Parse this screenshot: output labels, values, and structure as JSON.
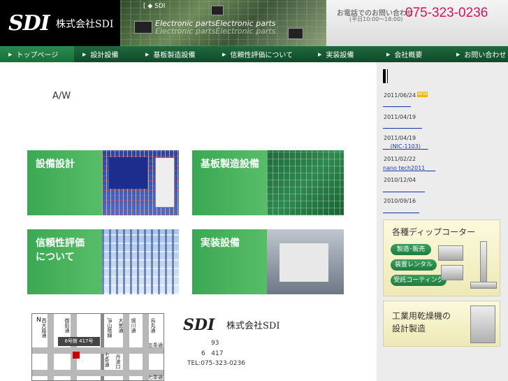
{
  "header": {
    "logo_mark": "SDI",
    "logo_text": "株式会社SDI",
    "sdi_tag": "[ ◆ SDI",
    "tagline1": "Electronic partsElectronic parts",
    "tagline2": "Electronic partsElectronic parts",
    "contact_label": "お電話でのお問い合わせ",
    "contact_hours": "(平日10:00〜18:00)",
    "contact_phone": "075-323-0236"
  },
  "nav": {
    "items": [
      {
        "label": "トップページ"
      },
      {
        "label": "設計設備"
      },
      {
        "label": "基板製造設備"
      },
      {
        "label": "信頼性評価について"
      },
      {
        "label": "実装設備"
      },
      {
        "label": "会社概要"
      },
      {
        "label": "お問い合わせ"
      }
    ],
    "arrow": "▶"
  },
  "main": {
    "aw_label": "A/W",
    "tiles": [
      {
        "label": "設備設計"
      },
      {
        "label": "基板製造設備"
      },
      {
        "label": "信頼性評価\nについて"
      },
      {
        "label": "実装設備"
      }
    ]
  },
  "map": {
    "north": "N",
    "badge": "6号館 417号",
    "labels": {
      "l1": "西大路通",
      "l2": "御前通",
      "l3": "JR山陰線",
      "l4": "大宮通",
      "l5": "堀川通",
      "l6": "烏丸通",
      "l7": "五条通",
      "l8": "七条通",
      "l9": "丹波口",
      "l10": "七条通"
    }
  },
  "company": {
    "mark": "SDI",
    "name": "株式会社SDI",
    "addr1": "93",
    "addr2": "6   417",
    "tel": "TEL:075-323-0236"
  },
  "news": {
    "badge": "NEW",
    "items": [
      {
        "date": "2011/06/24",
        "link": "__________"
      },
      {
        "date": "2011/04/19",
        "link": "______________"
      },
      {
        "date": "2011/04/19",
        "link": "__ (NIC-1103) __"
      },
      {
        "date": "2011/02/22",
        "link": "nano tech2011 ___"
      },
      {
        "date": "2010/12/04",
        "link": "_______________"
      },
      {
        "date": "2010/09/16",
        "link": "_____________"
      }
    ]
  },
  "banners": {
    "coater_title": "各種ディップコーター",
    "pill_sales": "製造･販売",
    "pill_rental": "装置レンタル",
    "pill_consign": "受託コーティング",
    "dryer_title_1": "工業用乾燥機の",
    "dryer_title_2": "設計製造"
  }
}
